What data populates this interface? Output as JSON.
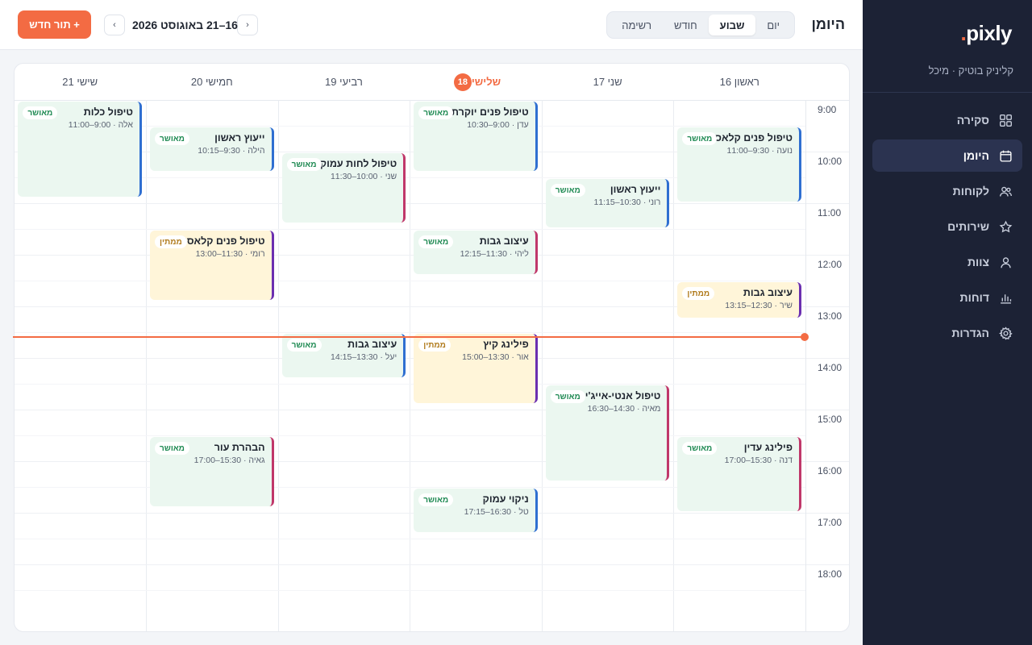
{
  "sidebar": {
    "logo": "pixly",
    "logo_dot": ".",
    "clinic": "קליניק בוטיק · מיכל",
    "items": [
      {
        "label": "סקירה",
        "icon": "grid-icon",
        "active": false
      },
      {
        "label": "היומן",
        "icon": "calendar-icon",
        "active": true
      },
      {
        "label": "לקוחות",
        "icon": "users-icon",
        "active": false
      },
      {
        "label": "שירותים",
        "icon": "star-icon",
        "active": false
      },
      {
        "label": "צוות",
        "icon": "user-icon",
        "active": false
      },
      {
        "label": "דוחות",
        "icon": "bar-chart-icon",
        "active": false
      },
      {
        "label": "הגדרות",
        "icon": "gear-icon",
        "active": false
      }
    ]
  },
  "header": {
    "title": "היומן",
    "views": [
      "יום",
      "שבוע",
      "חודש",
      "רשימה"
    ],
    "active_view": "שבוע",
    "prev_label": "‹",
    "next_label": "›",
    "range": "16–21 באוגוסט 2026",
    "new_button": "+ תור חדש"
  },
  "colors": {
    "accent": "#f36b43",
    "sidebar": "#1c2235",
    "confirmed_bg": "#ebf7f0",
    "pending_bg": "#fff5d9"
  },
  "calendar": {
    "days": [
      {
        "label": "ראשון 16",
        "today": false
      },
      {
        "label": "שני 17",
        "today": false
      },
      {
        "label": "שלישי",
        "today": true,
        "date": "18"
      },
      {
        "label": "רביעי 19",
        "today": false
      },
      {
        "label": "חמישי 20",
        "today": false
      },
      {
        "label": "שישי 21",
        "today": false
      }
    ],
    "hours": [
      "9:00",
      "10:00",
      "11:00",
      "12:00",
      "13:00",
      "14:00",
      "15:00",
      "16:00",
      "17:00",
      "18:00"
    ],
    "statuses": {
      "confirmed": "מאושר",
      "pending": "ממתין"
    },
    "events": [
      {
        "day": 0,
        "title": "טיפול פנים קלאסי",
        "sub": "נועה · 9:30–11:00",
        "status": "מאושר",
        "start": 9.5,
        "end": 11,
        "accent": "#2f6fd1"
      },
      {
        "day": 0,
        "title": "עיצוב גבות",
        "sub": "שיר · 12:30–13:15",
        "status": "ממתין",
        "start": 12.5,
        "end": 13.25,
        "accent": "#6b2fb0"
      },
      {
        "day": 0,
        "title": "פילינג עדין",
        "sub": "דנה · 15:30–17:00",
        "status": "מאושר",
        "start": 15.5,
        "end": 17,
        "accent": "#c0376a"
      },
      {
        "day": 1,
        "title": "ייעוץ ראשון",
        "sub": "רוני · 10:30–11:15",
        "status": "מאושר",
        "start": 10.5,
        "end": 11.5,
        "accent": "#2f6fd1"
      },
      {
        "day": 1,
        "title": "טיפול אנטי-אייג'ינג",
        "sub": "מאיה · 14:30–16:30",
        "status": "מאושר",
        "start": 14.5,
        "end": 16.4,
        "accent": "#c0376a"
      },
      {
        "day": 2,
        "title": "טיפול פנים יוקרתי",
        "sub": "עדן · 9:00–10:30",
        "status": "מאושר",
        "start": 9,
        "end": 10.4,
        "accent": "#2f6fd1"
      },
      {
        "day": 2,
        "title": "עיצוב גבות",
        "sub": "ליהי · 11:30–12:15",
        "status": "מאושר",
        "start": 11.5,
        "end": 12.4,
        "accent": "#c0376a"
      },
      {
        "day": 2,
        "title": "פילינג קיץ",
        "sub": "אור · 13:30–15:00",
        "status": "ממתין",
        "start": 13.5,
        "end": 14.9,
        "accent": "#6b2fb0"
      },
      {
        "day": 2,
        "title": "ניקוי עמוק",
        "sub": "טל · 16:30–17:15",
        "status": "מאושר",
        "start": 16.5,
        "end": 17.4,
        "accent": "#2f6fd1"
      },
      {
        "day": 3,
        "title": "טיפול לחות עמוק",
        "sub": "שני · 10:00–11:30",
        "status": "מאושר",
        "start": 10,
        "end": 11.4,
        "accent": "#c0376a"
      },
      {
        "day": 3,
        "title": "עיצוב גבות",
        "sub": "יעל · 13:30–14:15",
        "status": "מאושר",
        "start": 13.5,
        "end": 14.4,
        "accent": "#2f6fd1"
      },
      {
        "day": 4,
        "title": "ייעוץ ראשון",
        "sub": "הילה · 9:30–10:15",
        "status": "מאושר",
        "start": 9.5,
        "end": 10.4,
        "accent": "#2f6fd1"
      },
      {
        "day": 4,
        "title": "טיפול פנים קלאסי",
        "sub": "רומי · 11:30–13:00",
        "status": "ממתין",
        "start": 11.5,
        "end": 12.9,
        "accent": "#6b2fb0"
      },
      {
        "day": 4,
        "title": "הבהרת עור",
        "sub": "גאיה · 15:30–17:00",
        "status": "מאושר",
        "start": 15.5,
        "end": 16.9,
        "accent": "#c0376a"
      },
      {
        "day": 5,
        "title": "טיפול כלות",
        "sub": "אלה · 9:00–11:00",
        "status": "מאושר",
        "start": 9,
        "end": 10.9,
        "accent": "#2f6fd1"
      }
    ],
    "now_hour": 13.6
  }
}
